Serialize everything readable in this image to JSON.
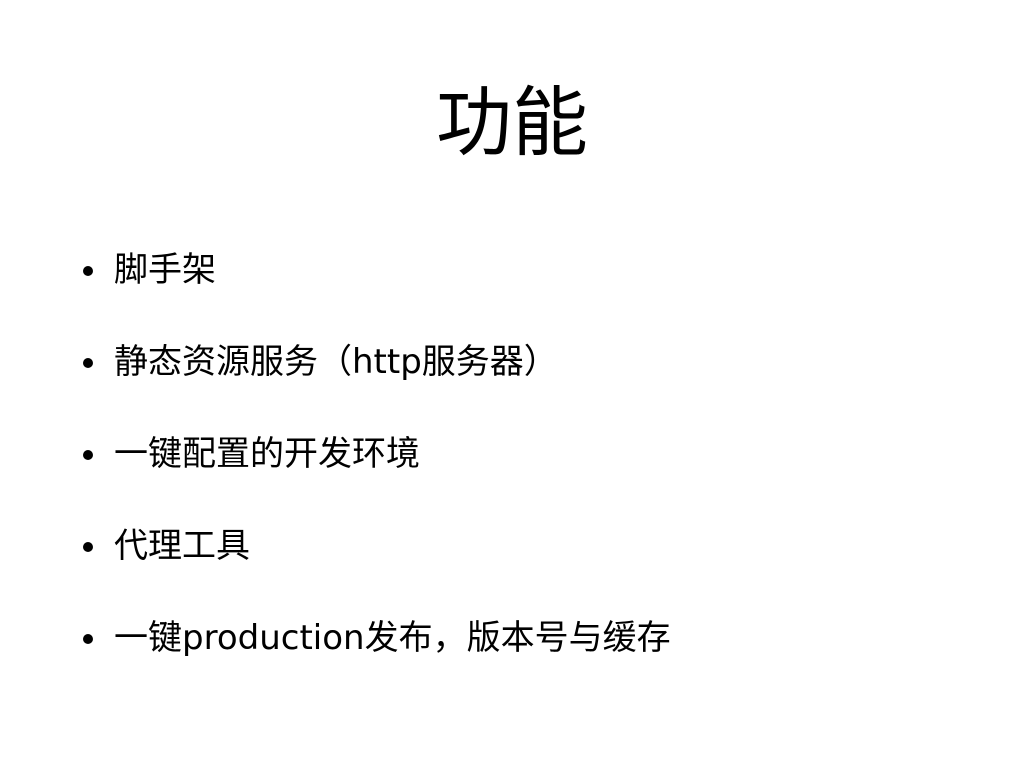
{
  "slide": {
    "title": "功能",
    "bullets": [
      {
        "text": "脚手架"
      },
      {
        "text": "静态资源服务（http服务器）"
      },
      {
        "text": "一键配置的开发环境"
      },
      {
        "text": "代理工具"
      },
      {
        "text": "一键production发布，版本号与缓存"
      }
    ]
  }
}
